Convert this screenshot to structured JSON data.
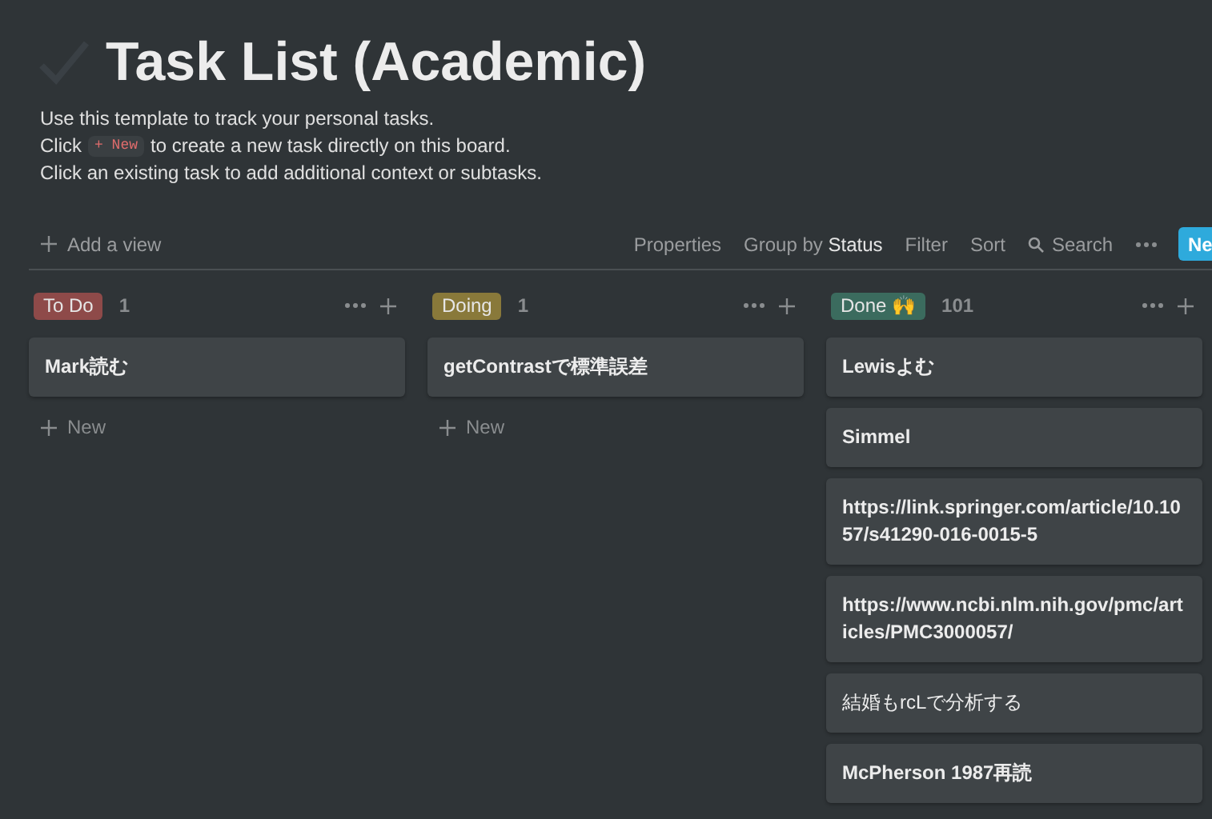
{
  "page": {
    "title": "Task List (Academic)",
    "description": [
      {
        "kind": "text",
        "parts": [
          "Use this template to track your personal tasks."
        ]
      },
      {
        "kind": "chip",
        "parts": [
          "Click",
          "+ New",
          "to create a new task directly on this board."
        ]
      },
      {
        "kind": "text",
        "parts": [
          "Click an existing task to add additional context or subtasks."
        ]
      }
    ]
  },
  "toolbar": {
    "add_view": "Add a view",
    "items": [
      {
        "kind": "text",
        "label": "Properties"
      },
      {
        "kind": "text",
        "label": "Group by **Status**"
      },
      {
        "kind": "text",
        "label": "Filter"
      },
      {
        "kind": "text",
        "label": "Sort"
      },
      {
        "kind": "search",
        "label": "Search"
      },
      {
        "kind": "more"
      }
    ],
    "new_button": "Ne"
  },
  "columns": [
    {
      "tag": "To Do",
      "color": "#8e4a49",
      "count": "1",
      "cards": [
        {
          "title": "Mark読む",
          "bold": true
        }
      ],
      "new_label": "New"
    },
    {
      "tag": "Doing",
      "color": "#89793a",
      "count": "1",
      "cards": [
        {
          "title": "getContrastで標準誤差",
          "bold": true
        }
      ],
      "new_label": "New"
    },
    {
      "tag": "Done 🙌",
      "color": "#3b6b5e",
      "count": "101",
      "cards": [
        {
          "title": "Lewisよむ",
          "bold": true
        },
        {
          "title": "Simmel",
          "bold": true
        },
        {
          "title": "https://link.springer.com/article/10.1057/s41290-016-0015-5",
          "bold": true
        },
        {
          "title": "https://www.ncbi.nlm.nih.gov/pmc/articles/PMC3000057/",
          "bold": true
        },
        {
          "title": "結婚もrcLで分析する",
          "bold": false
        },
        {
          "title": "McPherson 1987再読",
          "bold": true
        }
      ]
    }
  ]
}
